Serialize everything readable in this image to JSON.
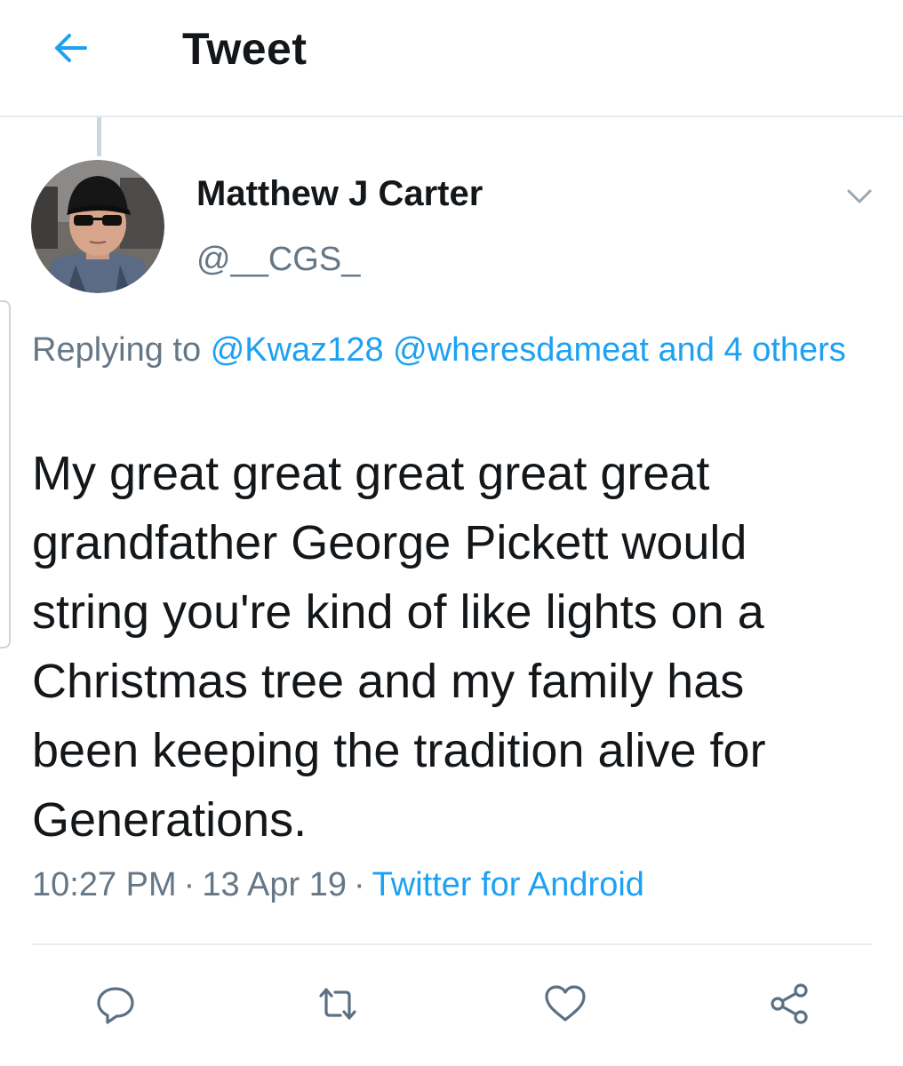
{
  "header": {
    "title": "Tweet"
  },
  "tweet": {
    "author_name": "Matthew J Carter",
    "author_handle": "@__CGS_",
    "reply_prefix": "Replying to",
    "reply_mentions": [
      "@Kwaz128",
      "@wheresdameat"
    ],
    "reply_others": "and 4 others",
    "text": "My great great great great great\ngrandfather George Pickett would\nstring you're kind of like lights on a\nChristmas tree and my family has\nbeen keeping the tradition alive for\nGenerations.",
    "time": "10:27 PM",
    "date": "13 Apr 19",
    "source": "Twitter for Android",
    "separator": "·"
  },
  "icons": {
    "back": "arrow-left-icon",
    "caret": "chevron-down-icon",
    "reply": "reply-icon",
    "retweet": "retweet-icon",
    "like": "heart-icon",
    "share": "share-icon"
  },
  "colors": {
    "accent": "#1da1f2",
    "secondary_text": "#657786",
    "primary_text": "#14171a",
    "divider": "#e6ecf0"
  }
}
